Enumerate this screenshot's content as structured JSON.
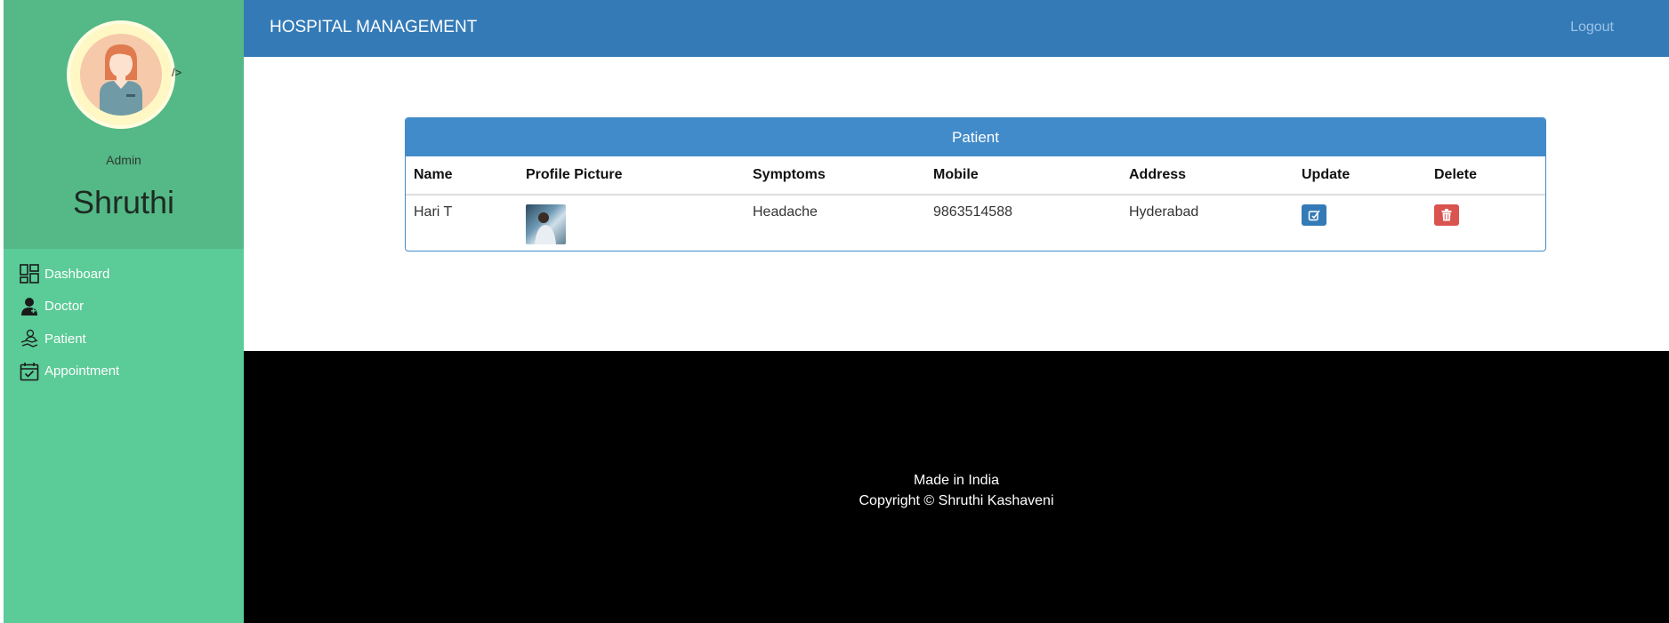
{
  "sidebar": {
    "stray_text": "/>",
    "role": "Admin",
    "name": "Shruthi",
    "items": [
      {
        "label": "Dashboard",
        "icon": "dashboard-icon"
      },
      {
        "label": "Doctor",
        "icon": "doctor-icon"
      },
      {
        "label": "Patient",
        "icon": "patient-icon"
      },
      {
        "label": "Appointment",
        "icon": "calendar-icon"
      }
    ]
  },
  "header": {
    "title": "HOSPITAL MANAGEMENT",
    "logout_label": "Logout"
  },
  "patients_panel": {
    "title": "Patient",
    "columns": [
      "Name",
      "Profile Picture",
      "Symptoms",
      "Mobile",
      "Address",
      "Update",
      "Delete"
    ],
    "rows": [
      {
        "name": "Hari T",
        "symptoms": "Headache",
        "mobile": "9863514588",
        "address": "Hyderabad"
      }
    ]
  },
  "footer": {
    "line1": "Made in India",
    "line2": "Copyright © Shruthi Kashaveni"
  },
  "colors": {
    "sidebar": "#5bcb97",
    "sidebar_top": "#55b887",
    "header": "#337ab7",
    "panel_head": "#428bca",
    "update_button": "#337ab7",
    "delete_button": "#d9534f",
    "footer": "#000000"
  }
}
